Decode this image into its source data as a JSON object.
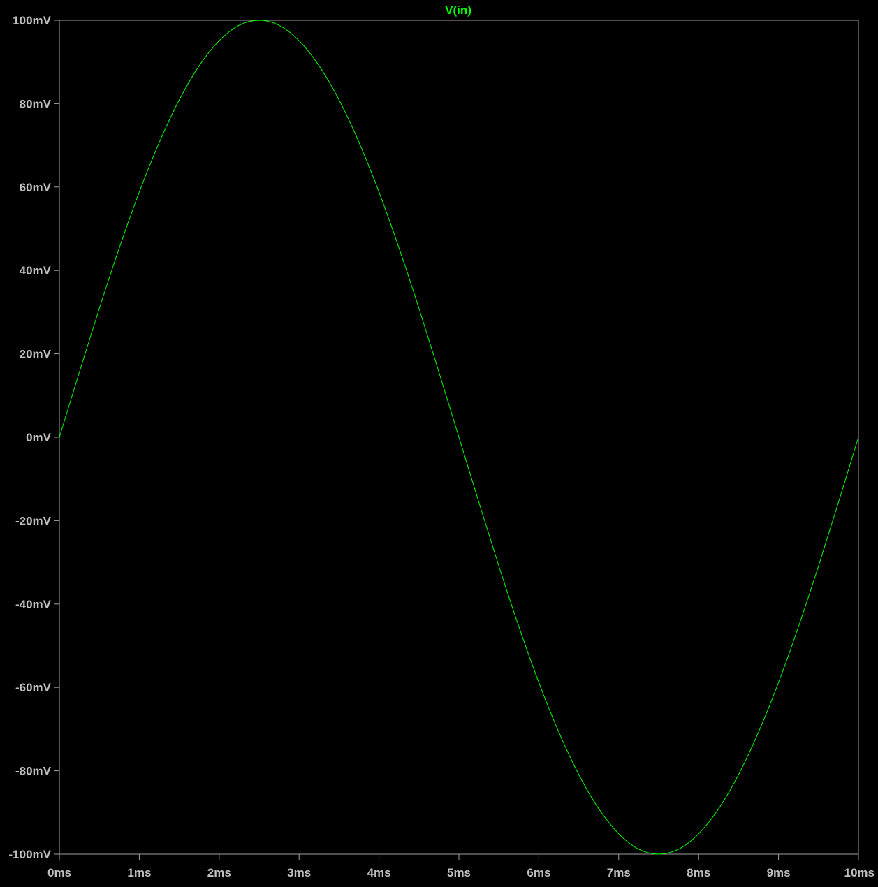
{
  "chart_data": {
    "type": "line",
    "title": "V(in)",
    "xlabel": "",
    "ylabel": "",
    "xlim": [
      0,
      10
    ],
    "ylim": [
      -100,
      100
    ],
    "grid": false,
    "x_ticks": [
      0,
      1,
      2,
      3,
      4,
      5,
      6,
      7,
      8,
      9,
      10
    ],
    "x_tick_labels": [
      "0ms",
      "1ms",
      "2ms",
      "3ms",
      "4ms",
      "5ms",
      "6ms",
      "7ms",
      "8ms",
      "9ms",
      "10ms"
    ],
    "y_ticks": [
      100,
      80,
      60,
      40,
      20,
      0,
      -20,
      -40,
      -60,
      -80,
      -100
    ],
    "y_tick_labels": [
      "100mV",
      "80mV",
      "60mV",
      "40mV",
      "20mV",
      "0mV",
      "-20mV",
      "-40mV",
      "-60mV",
      "-80mV",
      "-100mV"
    ],
    "series": [
      {
        "name": "V(in)",
        "color": "#00ff00",
        "x": [
          0,
          0.25,
          0.5,
          0.75,
          1,
          1.25,
          1.5,
          1.75,
          2,
          2.25,
          2.5,
          2.75,
          3,
          3.25,
          3.5,
          3.75,
          4,
          4.25,
          4.5,
          4.75,
          5,
          5.25,
          5.5,
          5.75,
          6,
          6.25,
          6.5,
          6.75,
          7,
          7.25,
          7.5,
          7.75,
          8,
          8.25,
          8.5,
          8.75,
          9,
          9.25,
          9.5,
          9.75,
          10
        ],
        "y": [
          0,
          15.6,
          30.9,
          45.4,
          58.8,
          70.7,
          80.9,
          89.1,
          95.1,
          98.8,
          100,
          98.8,
          95.1,
          89.1,
          80.9,
          70.7,
          58.8,
          45.4,
          30.9,
          15.6,
          0,
          -15.6,
          -30.9,
          -45.4,
          -58.8,
          -70.7,
          -80.9,
          -89.1,
          -95.1,
          -98.8,
          -100,
          -98.8,
          -95.1,
          -89.1,
          -80.9,
          -70.7,
          -58.8,
          -45.4,
          -30.9,
          -15.6,
          0
        ]
      }
    ]
  },
  "colors": {
    "background": "#000000",
    "frame": "#a0a0a0",
    "text": "#c0c0c0",
    "trace": "#00ff00"
  }
}
